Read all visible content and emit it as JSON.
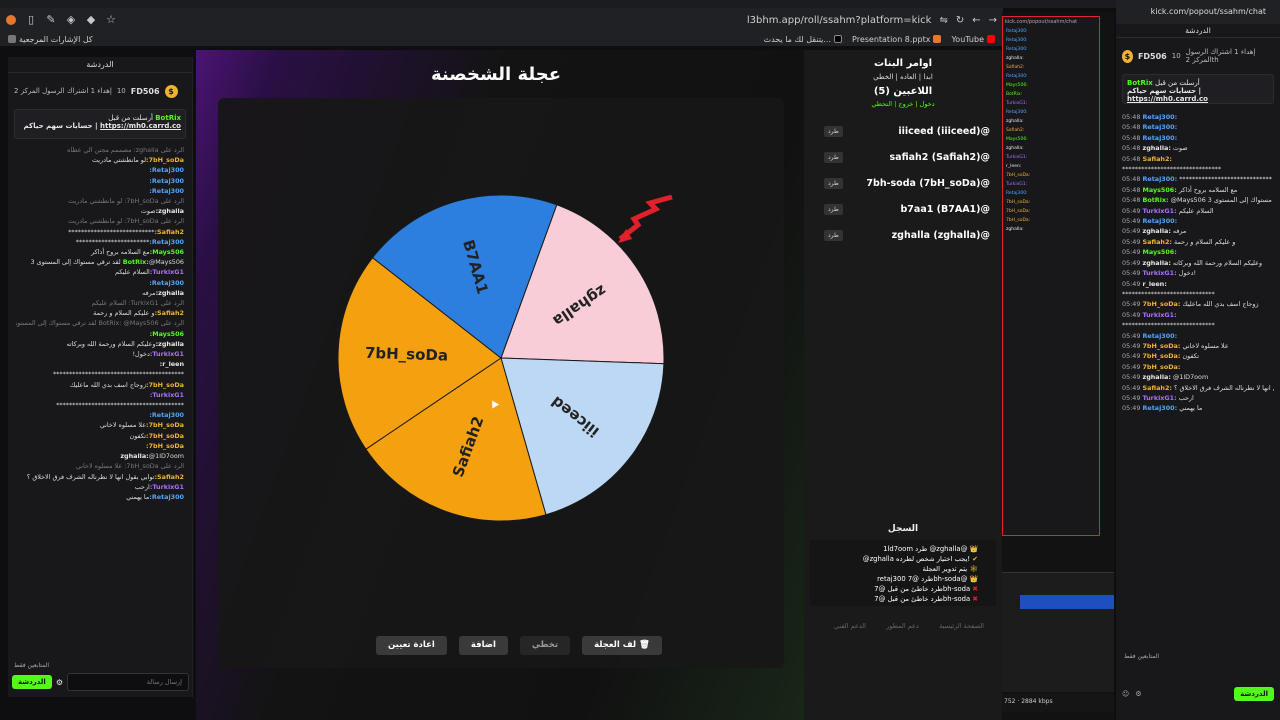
{
  "browser": {
    "url": "l3bhm.app/roll/ssahm?platform=kick",
    "bookmarks": [
      "كل الإشارات المرجعية",
      "يتنقل لك ما يحدث...",
      "Presentation 8.pptx",
      "YouTube"
    ]
  },
  "left_chat": {
    "header": "الدردشة",
    "pinned": {
      "name": "FD506",
      "level": "10",
      "text": "إهداء 1 اشتراك الرسول المركز 2"
    },
    "bot": {
      "name": "BotRix",
      "line1": "أرسلت من قبل",
      "line2": "حسابات سهم حياكم |",
      "link": "https://mh0.carrd.co"
    },
    "messages": [
      {
        "u": "",
        "t": "الرد على zghalla: مصممم مجنن الي عطاه",
        "cls": "reply"
      },
      {
        "u": "7bH_soDa:",
        "t": "لو مانطشتي مادريت",
        "cls": "u-7b"
      },
      {
        "u": "Retaj300:",
        "t": "",
        "cls": "u-ret"
      },
      {
        "u": "Retaj300:",
        "t": "",
        "cls": "u-ret"
      },
      {
        "u": "Retaj300:",
        "t": "",
        "cls": "u-ret"
      },
      {
        "u": "",
        "t": "الرد على 7bH_soDa: لو مانطشتي مادريت",
        "cls": "reply"
      },
      {
        "u": "zghalla:",
        "t": "صوت",
        "cls": "u-zg"
      },
      {
        "u": "",
        "t": "الرد على 7bH_soDa: لو مانطشتي مادريت",
        "cls": "reply"
      },
      {
        "u": "Safiah2:",
        "t": "***************************",
        "cls": "u-saf"
      },
      {
        "u": "Retaj300:",
        "t": "***********************",
        "cls": "u-ret"
      },
      {
        "u": "Mays506:",
        "t": "مع السلامه بروح أذاكر",
        "cls": "u-may"
      },
      {
        "u": "BotRix:",
        "t": "@Mays506 لقد ترقي مستواك إلى المستوى 3",
        "cls": "u-may"
      },
      {
        "u": "TurkixG1:",
        "t": "السلام عليكم",
        "cls": "u-tur"
      },
      {
        "u": "Retaj300:",
        "t": "",
        "cls": "u-ret"
      },
      {
        "u": "zghalla:",
        "t": "مرفه",
        "cls": "u-zg"
      },
      {
        "u": "",
        "t": "الرد على TurkixG1: السلام عليكم",
        "cls": "reply"
      },
      {
        "u": "Safiah2:",
        "t": "و عليكم السلام و رحمة",
        "cls": "u-saf"
      },
      {
        "u": "",
        "t": "الرد على BotRix: @Mays506 لقد ترقي مستواك إلى المستوى 3",
        "cls": "reply"
      },
      {
        "u": "Mays506:",
        "t": "",
        "cls": "u-may"
      },
      {
        "u": "zghalla:",
        "t": "وعليكم السلام ورحمة الله وبركاته",
        "cls": "u-zg"
      },
      {
        "u": "TurkixG1:",
        "t": "دخول!",
        "cls": "u-tur"
      },
      {
        "u": "r_leen:",
        "t": "",
        "cls": "u-zg"
      },
      {
        "u": "",
        "t": "*****************************************",
        "cls": "u-zg"
      },
      {
        "u": "7bH_soDa:",
        "t": "زوجاج اسف بدي الله ماعليك",
        "cls": "u-7b"
      },
      {
        "u": "TurkixG1:",
        "t": "",
        "cls": "u-tur"
      },
      {
        "u": "",
        "t": "****************************************",
        "cls": "u-zg"
      },
      {
        "u": "Retaj300:",
        "t": "",
        "cls": "u-ret"
      },
      {
        "u": "7bH_soDa:",
        "t": "علا مسلوه لاخاني",
        "cls": "u-7b"
      },
      {
        "u": "7bH_soDa:",
        "t": "تكفون",
        "cls": "u-7b"
      },
      {
        "u": "7bH_soDa:",
        "t": "",
        "cls": "u-7b"
      },
      {
        "u": "zghalla:",
        "t": "@1lD7oom",
        "cls": "u-zg"
      },
      {
        "u": "",
        "t": "الرد على 7bH_soDa: علا مسلوه لاخاني",
        "cls": "reply"
      },
      {
        "u": "Safiah2:",
        "t": "توابي بقول انها لا نطرناله الشرف فرق الاخلاق ؟",
        "cls": "u-saf"
      },
      {
        "u": "TurkixG1:",
        "t": "ارحب",
        "cls": "u-tur"
      },
      {
        "u": "Retaj300:",
        "t": "ما يهمني",
        "cls": "u-ret"
      }
    ],
    "followers_only": "المتابعين فقط",
    "input_placeholder": "إرسال رسالة",
    "chat_button": "الدردشة"
  },
  "game": {
    "title": "عجلة الشخصنة",
    "buttons": {
      "spin": "لف العجلة",
      "skip": "تخطي",
      "add": "اضافة",
      "reset": "اعادة تعيين"
    }
  },
  "side": {
    "title": "اوامر البنات",
    "subtitle": "ابدا | العاده | الخطي",
    "players_count": "اللاعبين (5)",
    "join_links": "دخول | خروج | التخطي",
    "kick_label": "طرد",
    "players": [
      "iiiceed (iiiceed)@",
      "safiah2 (Safiah2)@",
      "7bh-soda (7bH_soDa)@",
      "b7aa1 (B7AA1)@",
      "zghalla (zghalla)@"
    ],
    "log_title": "السجل",
    "log": [
      "1ld7oom طرد @zghalla@",
      "@zghalla يجب اختيار شخص لطرده!",
      "يتم تدوير العجلة",
      "retaj300 طرد @7bh-soda@",
      "طرد خاطئ من قبل @7bh-soda",
      "طرد خاطئ من قبل @7bh-soda"
    ],
    "footer": [
      "الصفحة الرئيسية",
      "دعم المطور",
      "الدعم الفني"
    ]
  },
  "wheel": {
    "segments": [
      {
        "label": "zghalla",
        "color": "#f8cdd8",
        "value": 1
      },
      {
        "label": "iiiceed",
        "color": "#bcd8f5",
        "value": 1
      },
      {
        "label": "Safiah2",
        "color": "#f5a10f",
        "value": 1
      },
      {
        "label": "7bH_soDa",
        "color": "#f5a10f",
        "value": 1
      },
      {
        "label": "B7AA1",
        "color": "#2c7fde",
        "value": 1
      }
    ]
  },
  "right_stream": {
    "url": "kick.com/popout/ssahm/chat",
    "status": "2884 kbps",
    "viewer": "752"
  },
  "right_chat": {
    "url": "kick.com/popout/ssahm/chat",
    "header": "الدردشة",
    "pinned": {
      "name": "FD506",
      "level": "10",
      "text": "إهداء 1 اشتراك الرسول المركز 2th"
    },
    "bot": {
      "name": "BotRix",
      "line1": "أرسلت من قبل",
      "line2": "حسابات سهم حياكم |",
      "link": "https://mh0.carrd.co"
    },
    "messages": [
      {
        "time": "05:48",
        "u": "Retaj300:",
        "t": "",
        "cls": "u-ret"
      },
      {
        "time": "05:48",
        "u": "Retaj300:",
        "t": "",
        "cls": "u-ret"
      },
      {
        "time": "05:48",
        "u": "Retaj300:",
        "t": "",
        "cls": "u-ret"
      },
      {
        "time": "05:48",
        "u": "zghalla:",
        "t": "صوت",
        "cls": "u-zg"
      },
      {
        "time": "05:48",
        "u": "Safiah2:",
        "t": "",
        "cls": "u-saf"
      },
      {
        "time": "",
        "u": "",
        "t": "*******************************",
        "cls": "u-zg"
      },
      {
        "time": "05:48",
        "u": "Retaj300:",
        "t": "*****************************",
        "cls": "u-ret"
      },
      {
        "time": "05:48",
        "u": "Mays506:",
        "t": "مع السلامه بروح أذاكر",
        "cls": "u-may"
      },
      {
        "time": "05:48",
        "u": "BotRix:",
        "t": "@Mays506 لقد ترقي مستواك إلى المستوى 3",
        "cls": "u-may"
      },
      {
        "time": "05:49",
        "u": "TurkixG1:",
        "t": "السلام عليكم",
        "cls": "u-tur"
      },
      {
        "time": "05:49",
        "u": "Retaj300:",
        "t": "",
        "cls": "u-ret"
      },
      {
        "time": "05:49",
        "u": "zghalla:",
        "t": "مرفه",
        "cls": "u-zg"
      },
      {
        "time": "05:49",
        "u": "Safiah2:",
        "t": "و عليكم السلام و رحمة",
        "cls": "u-saf"
      },
      {
        "time": "05:49",
        "u": "Mays506:",
        "t": "",
        "cls": "u-may"
      },
      {
        "time": "05:49",
        "u": "zghalla:",
        "t": "وعليكم السلام ورحمة الله وبركاته",
        "cls": "u-zg"
      },
      {
        "time": "05:49",
        "u": "TurkixG1:",
        "t": "دخول!",
        "cls": "u-tur"
      },
      {
        "time": "05:49",
        "u": "r_leen:",
        "t": "",
        "cls": "u-zg"
      },
      {
        "time": "",
        "u": "",
        "t": "*****************************",
        "cls": "u-zg"
      },
      {
        "time": "05:49",
        "u": "7bH_soDa:",
        "t": "زوجاج اسف بدي الله ماعليك",
        "cls": "u-7b"
      },
      {
        "time": "05:49",
        "u": "TurkixG1:",
        "t": "",
        "cls": "u-tur"
      },
      {
        "time": "",
        "u": "",
        "t": "*****************************",
        "cls": "u-zg"
      },
      {
        "time": "05:49",
        "u": "Retaj300:",
        "t": "",
        "cls": "u-ret"
      },
      {
        "time": "05:49",
        "u": "7bH_soDa:",
        "t": "علا مسلوه لاخاني",
        "cls": "u-7b"
      },
      {
        "time": "05:49",
        "u": "7bH_soDa:",
        "t": "تكفون",
        "cls": "u-7b"
      },
      {
        "time": "05:49",
        "u": "7bH_soDa:",
        "t": "",
        "cls": "u-7b"
      },
      {
        "time": "05:49",
        "u": "zghalla:",
        "t": "@1lD7oom",
        "cls": "u-zg"
      },
      {
        "time": "05:49",
        "u": "Safiah2:",
        "t": "توابي بقول انها لا نطرناله الشرف فرق الاخلاق ؟",
        "cls": "u-saf"
      },
      {
        "time": "05:49",
        "u": "TurkixG1:",
        "t": "ارحب",
        "cls": "u-tur"
      },
      {
        "time": "05:49",
        "u": "Retaj300:",
        "t": "ما يهمني",
        "cls": "u-ret"
      }
    ],
    "followers_only": "المتابعين فقط",
    "chat_button": "الدردشة"
  }
}
